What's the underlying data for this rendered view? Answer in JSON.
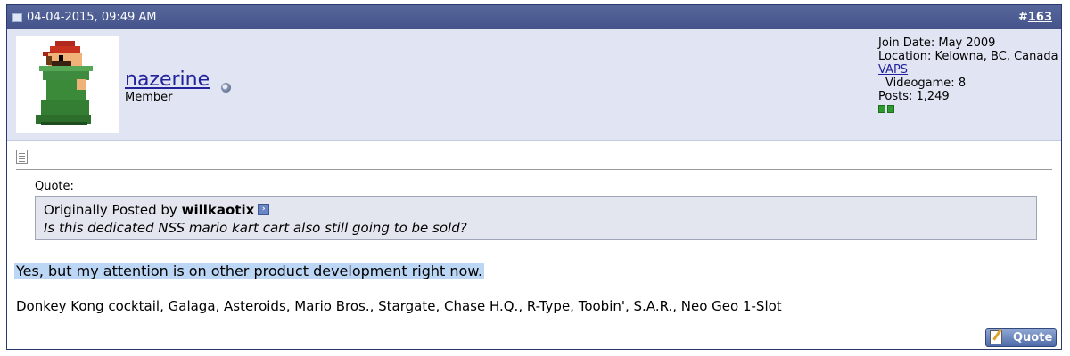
{
  "header": {
    "date": "04-04-2015, 09:49 AM",
    "post_number_prefix": "#",
    "post_number": "163"
  },
  "user": {
    "username": "nazerine",
    "title": "Member",
    "join_date": "Join Date: May 2009",
    "location": "Location: Kelowna, BC, Canada",
    "vaps_link": "VAPS",
    "videogame": "Videogame: 8",
    "posts": "Posts: 1,249",
    "status_icon": "offline-status-icon"
  },
  "post": {
    "quote_label": "Quote:",
    "quote_prefix": "Originally Posted by",
    "quote_author": "willkaotix",
    "quote_text": "Is this dedicated NSS mario kart cart also still going to be sold?",
    "message": "Yes, but my attention is on other product development right now.",
    "signature": "Donkey Kong cocktail, Galaga, Asteroids, Mario Bros., Stargate, Chase H.Q., R-Type, Toobin', S.A.R., Neo Geo 1-Slot"
  },
  "actions": {
    "quote_button": "Quote"
  },
  "colors": {
    "header_bg": "#4f5e8f",
    "userinfo_bg": "#e1e4f2",
    "link": "#22229c",
    "highlight": "#bcd6f5"
  }
}
